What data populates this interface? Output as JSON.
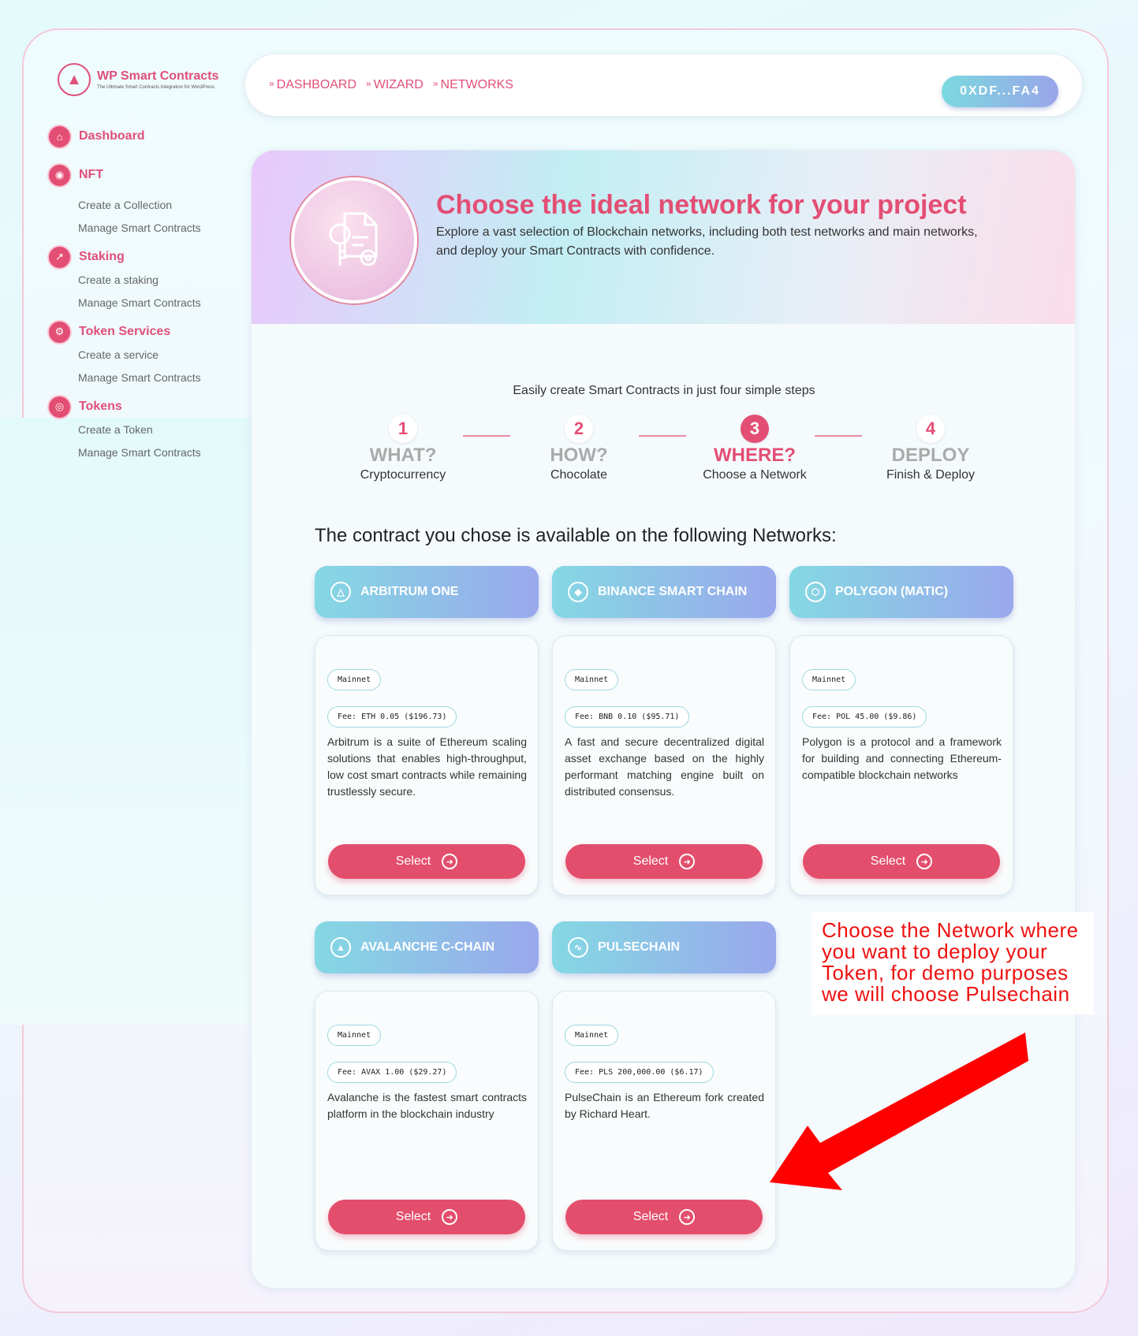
{
  "logo": {
    "title": "WP Smart Contracts",
    "subtitle": "The Ultimate Smart Contracts Integration for WordPress"
  },
  "sidebar": {
    "groups": [
      {
        "label": "Dashboard",
        "icon": "home-icon",
        "items": []
      },
      {
        "label": "NFT",
        "icon": "nft-icon",
        "items": [
          "Create a Collection",
          "Manage Smart Contracts"
        ]
      },
      {
        "label": "Staking",
        "icon": "chart-icon",
        "items": [
          "Create a staking",
          "Manage Smart Contracts"
        ]
      },
      {
        "label": "Token Services",
        "icon": "wrench-icon",
        "items": [
          "Create a service",
          "Manage Smart Contracts"
        ]
      },
      {
        "label": "Tokens",
        "icon": "coin-icon",
        "items": [
          "Create a Token",
          "Manage Smart Contracts"
        ]
      }
    ]
  },
  "breadcrumb": [
    "DASHBOARD",
    "WIZARD",
    "NETWORKS"
  ],
  "wallet": "0XDF...FA4",
  "hero": {
    "title": "Choose the ideal network for your project",
    "description": "Explore a vast selection of Blockchain networks, including both test networks and main networks, and deploy your Smart Contracts with confidence."
  },
  "steps": {
    "intro": "Easily create Smart Contracts in just four simple steps",
    "items": [
      {
        "num": "1",
        "title": "WHAT?",
        "sub": "Cryptocurrency"
      },
      {
        "num": "2",
        "title": "HOW?",
        "sub": "Chocolate"
      },
      {
        "num": "3",
        "title": "WHERE?",
        "sub": "Choose a Network"
      },
      {
        "num": "4",
        "title": "DEPLOY",
        "sub": "Finish & Deploy"
      }
    ],
    "active_index": 2
  },
  "available_heading": "The contract you chose is available on the following Networks:",
  "networks": [
    {
      "name": "ARBITRUM ONE",
      "type": "Mainnet",
      "fee": "Fee: ETH 0.05 ($196.73)",
      "description": "Arbitrum is a suite of Ethereum scaling solutions that enables high-throughput, low cost smart contracts while remaining trustlessly secure.",
      "icon": "arbitrum-icon"
    },
    {
      "name": "BINANCE SMART CHAIN",
      "type": "Mainnet",
      "fee": "Fee: BNB 0.10 ($95.71)",
      "description": "A fast and secure decentralized digital asset exchange based on the highly performant matching engine built on distributed consensus.",
      "icon": "binance-icon"
    },
    {
      "name": "POLYGON (MATIC)",
      "type": "Mainnet",
      "fee": "Fee: POL 45.00 ($9.86)",
      "description": "Polygon is a protocol and a framework for building and connecting Ethereum-compatible blockchain networks",
      "icon": "polygon-icon"
    },
    {
      "name": "AVALANCHE C-CHAIN",
      "type": "Mainnet",
      "fee": "Fee: AVAX 1.00 ($29.27)",
      "description": "Avalanche is the fastest smart contracts platform in the blockchain industry",
      "icon": "avalanche-icon"
    },
    {
      "name": "PULSECHAIN",
      "type": "Mainnet",
      "fee": "Fee: PLS 200,000.00 ($6.17)",
      "description": "PulseChain is an Ethereum fork created by Richard Heart.",
      "icon": "pulse-icon"
    }
  ],
  "select_label": "Select",
  "annotation": "Choose the Network where you want to deploy your Token, for demo purposes we will choose Pulsechain",
  "colors": {
    "accent": "#e34e74",
    "network_header_start": "#84d8e3",
    "network_header_end": "#9aa8ec",
    "annotation": "#ee1111"
  }
}
